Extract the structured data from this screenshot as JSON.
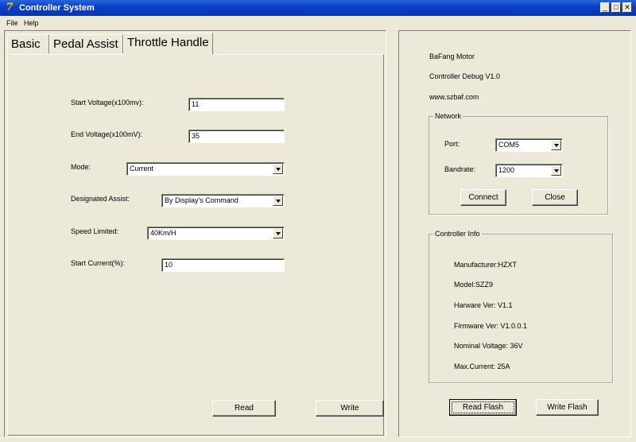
{
  "window": {
    "title": "Controller System",
    "icon": "app-logo-icon",
    "controls": {
      "minimize": "_",
      "maximize": "□",
      "close": "✕"
    }
  },
  "menu": [
    {
      "label": "File"
    },
    {
      "label": "Help"
    }
  ],
  "tabs": [
    {
      "label": "Basic",
      "active": false
    },
    {
      "label": "Pedal Assist",
      "active": false
    },
    {
      "label": "Throttle Handle",
      "active": true
    }
  ],
  "throttle": {
    "start_voltage": {
      "label": "Start Voltage(x100mv):",
      "value": "11"
    },
    "end_voltage": {
      "label": "End Voltage(x100mV):",
      "value": "35"
    },
    "mode": {
      "label": "Mode:",
      "value": "Current"
    },
    "designated_assist": {
      "label": "Designated Assist:",
      "value": "By Display's Command"
    },
    "speed_limited": {
      "label": "Speed Limited:",
      "value": "40Km/H"
    },
    "start_current": {
      "label": "Start Current(%):",
      "value": "10"
    },
    "read_label": "Read",
    "write_label": "Write"
  },
  "info": {
    "line1": "BaFang Motor",
    "line2": "Controller Debug V1.0",
    "line3": "www.szbaf.com"
  },
  "network": {
    "title": "Network",
    "port_label": "Port:",
    "port_value": "COM5",
    "baudrate_label": "Bandrate:",
    "baudrate_value": "1200",
    "connect_label": "Connect",
    "close_label": "Close"
  },
  "controller_info": {
    "title": "Controller Info",
    "manufacturer": "Manufacturer:HZXT",
    "model": "Model:SZZ9",
    "hardware_ver": "Harware Ver: V1.1",
    "firmware_ver": "Firmware Ver: V1.0.0.1",
    "nominal_voltage": "Nominal Voltage: 36V",
    "max_current": "Max.Current: 25A"
  },
  "flash": {
    "read_label": "Read Flash",
    "write_label": "Write Flash"
  }
}
